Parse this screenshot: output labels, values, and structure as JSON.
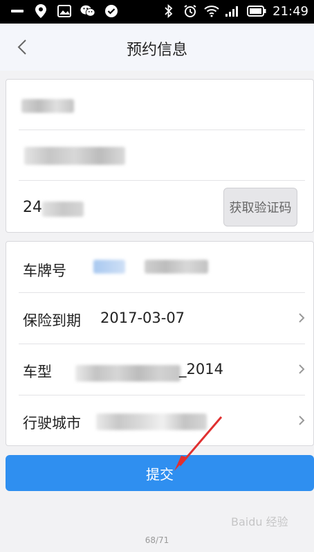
{
  "status_bar": {
    "time": "21:49",
    "left_icons": [
      "minus-icon",
      "location-icon",
      "image-icon",
      "wechat-icon",
      "check-circle-icon"
    ],
    "right_icons": [
      "bluetooth-icon",
      "alarm-icon",
      "wifi-icon",
      "signal-icon",
      "battery-icon"
    ]
  },
  "header": {
    "title": "预约信息",
    "back_icon": "chevron-left-icon"
  },
  "contact_card": {
    "phone_partial": "24",
    "get_code_label": "获取验证码"
  },
  "vehicle_card": {
    "plate_label": "车牌号",
    "insurance_label": "保险到期",
    "insurance_value": "2017-03-07",
    "model_label": "车型",
    "model_value_suffix": "_2014",
    "city_label": "行驶城市"
  },
  "submit_label": "提交",
  "page_indicator": "68/71",
  "watermark": "Baidu 经验"
}
